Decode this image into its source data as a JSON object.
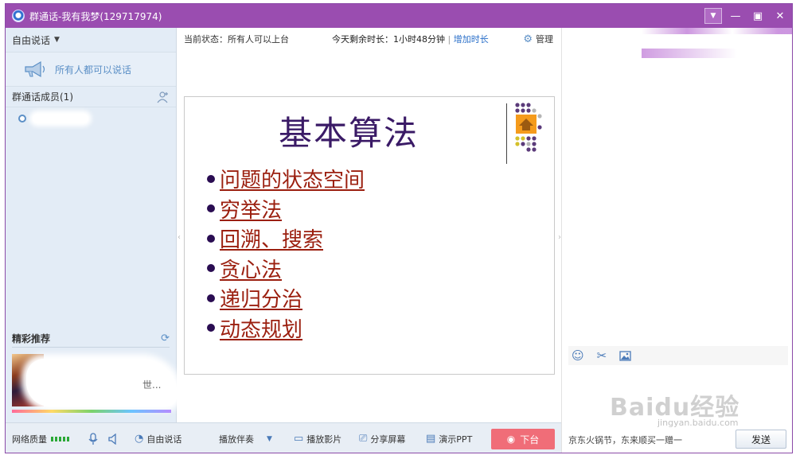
{
  "window": {
    "title": "群通话-我有我梦(129717974)"
  },
  "left": {
    "mode_label": "自由说话",
    "all_speak_label": "所有人都可以说话",
    "members_label": "群通话成员(1)",
    "recommend_label": "精彩推荐",
    "recommend_item_text": "世..."
  },
  "center": {
    "status_label": "当前状态：所有人可以上台",
    "remaining_label": "今天剩余时长：1小时48分钟",
    "add_time_link": "增加时长",
    "manage_label": "管理",
    "slide": {
      "title": "基本算法",
      "bullets": [
        "问题的状态空间",
        "穷举法",
        "回溯、搜索",
        "贪心法",
        "递归分治",
        "动态规划"
      ]
    }
  },
  "bottom": {
    "network_label": "网络质量",
    "free_speak_label": "自由说话",
    "accompaniment_label": "播放伴奏",
    "play_movie_label": "播放影片",
    "share_screen_label": "分享屏幕",
    "present_ppt_label": "演示PPT",
    "offstage_label": "下台"
  },
  "right": {
    "ad_text": "京东火锅节，东来顺买一赠一",
    "send_label": "发送",
    "watermark": "Baidu经验",
    "watermark_sub": "jingyan.baidu.com"
  },
  "colors": {
    "titlebar": "#9a4db0",
    "accent_blue": "#2a6fc9",
    "offstage_button": "#f06d78",
    "slide_title": "#3a1a66",
    "slide_bullet_text": "#9b1f0f"
  },
  "icons": {
    "app": "qq-logo-icon",
    "megaphone": "megaphone-icon",
    "add_member": "add-member-icon",
    "refresh": "refresh-icon",
    "manage": "gear-icon",
    "microphone": "microphone-icon",
    "speaker": "speaker-icon",
    "emoji": "emoji-icon",
    "screenshot": "scissors-icon",
    "image": "image-icon"
  }
}
